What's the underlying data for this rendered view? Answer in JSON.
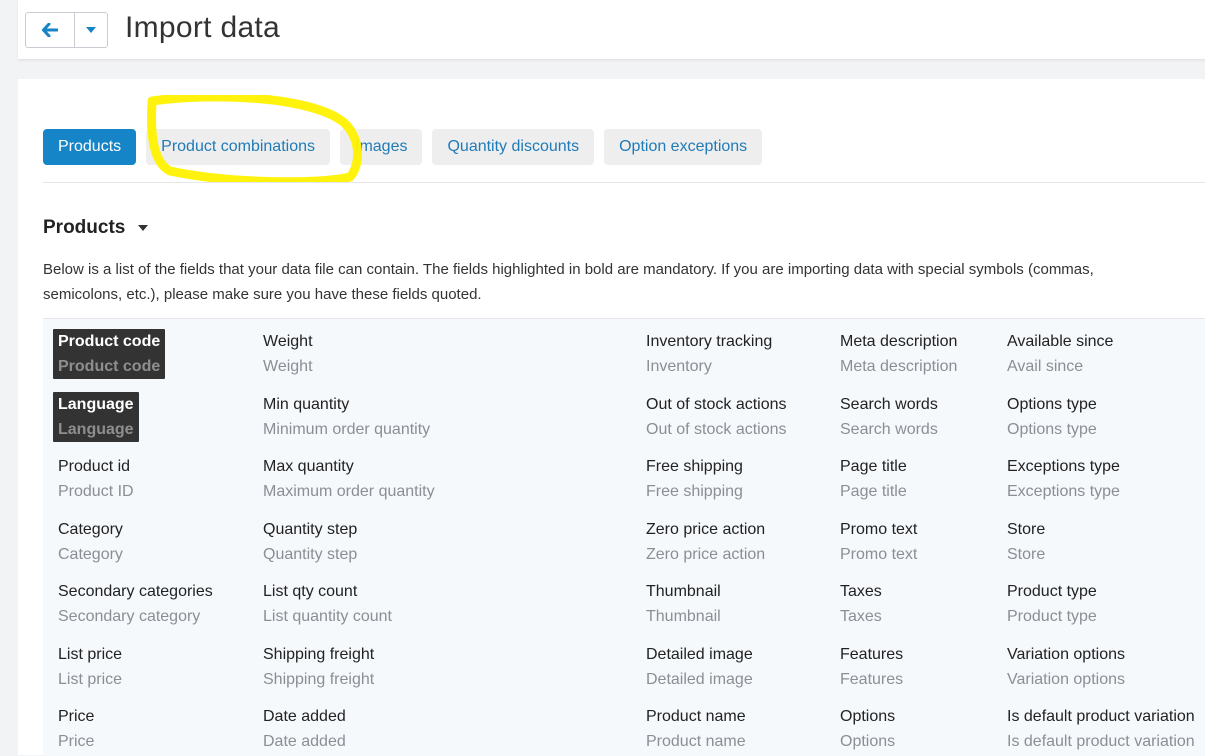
{
  "header": {
    "title": "Import data",
    "back_icon": "arrow-left-icon",
    "menu_icon": "caret-down-icon",
    "accent": "#1585c7"
  },
  "tabs": [
    {
      "label": "Products",
      "active": true
    },
    {
      "label": "Product combinations",
      "active": false
    },
    {
      "label": "Images",
      "active": false
    },
    {
      "label": "Quantity discounts",
      "active": false
    },
    {
      "label": "Option exceptions",
      "active": false
    }
  ],
  "annotation_color": "#fff200",
  "section": {
    "title": "Products",
    "description_line1": "Below is a list of the fields that your data file can contain. The fields highlighted in bold are mandatory. If you are importing data with special symbols (commas,",
    "description_line2": "semicolons, etc.), please make sure you have these fields quoted."
  },
  "fields": {
    "col1": [
      {
        "name": "Product code",
        "alias": "Product code",
        "mandatory": true
      },
      {
        "name": "Language",
        "alias": "Language",
        "mandatory": true
      },
      {
        "name": "Product id",
        "alias": "Product ID"
      },
      {
        "name": "Category",
        "alias": "Category"
      },
      {
        "name": "Secondary categories",
        "alias": "Secondary category"
      },
      {
        "name": "List price",
        "alias": "List price"
      },
      {
        "name": "Price",
        "alias": "Price"
      }
    ],
    "col2": [
      {
        "name": "Weight",
        "alias": "Weight"
      },
      {
        "name": "Min quantity",
        "alias": "Minimum order quantity"
      },
      {
        "name": "Max quantity",
        "alias": "Maximum order quantity"
      },
      {
        "name": "Quantity step",
        "alias": "Quantity step"
      },
      {
        "name": "List qty count",
        "alias": "List quantity count"
      },
      {
        "name": "Shipping freight",
        "alias": "Shipping freight"
      },
      {
        "name": "Date added",
        "alias": "Date added"
      }
    ],
    "col3": [
      {
        "name": "Inventory tracking",
        "alias": "Inventory"
      },
      {
        "name": "Out of stock actions",
        "alias": "Out of stock actions"
      },
      {
        "name": "Free shipping",
        "alias": "Free shipping"
      },
      {
        "name": "Zero price action",
        "alias": "Zero price action"
      },
      {
        "name": "Thumbnail",
        "alias": "Thumbnail"
      },
      {
        "name": "Detailed image",
        "alias": "Detailed image"
      },
      {
        "name": "Product name",
        "alias": "Product name"
      }
    ],
    "col4": [
      {
        "name": "Meta description",
        "alias": "Meta description"
      },
      {
        "name": "Search words",
        "alias": "Search words"
      },
      {
        "name": "Page title",
        "alias": "Page title"
      },
      {
        "name": "Promo text",
        "alias": "Promo text"
      },
      {
        "name": "Taxes",
        "alias": "Taxes"
      },
      {
        "name": "Features",
        "alias": "Features"
      },
      {
        "name": "Options",
        "alias": "Options"
      }
    ],
    "col5": [
      {
        "name": "Available since",
        "alias": "Avail since"
      },
      {
        "name": "Options type",
        "alias": "Options type"
      },
      {
        "name": "Exceptions type",
        "alias": "Exceptions type"
      },
      {
        "name": "Store",
        "alias": "Store"
      },
      {
        "name": "Product type",
        "alias": "Product type"
      },
      {
        "name": "Variation options",
        "alias": "Variation options"
      },
      {
        "name": "Is default product variation",
        "alias": "Is default product variation"
      }
    ]
  }
}
